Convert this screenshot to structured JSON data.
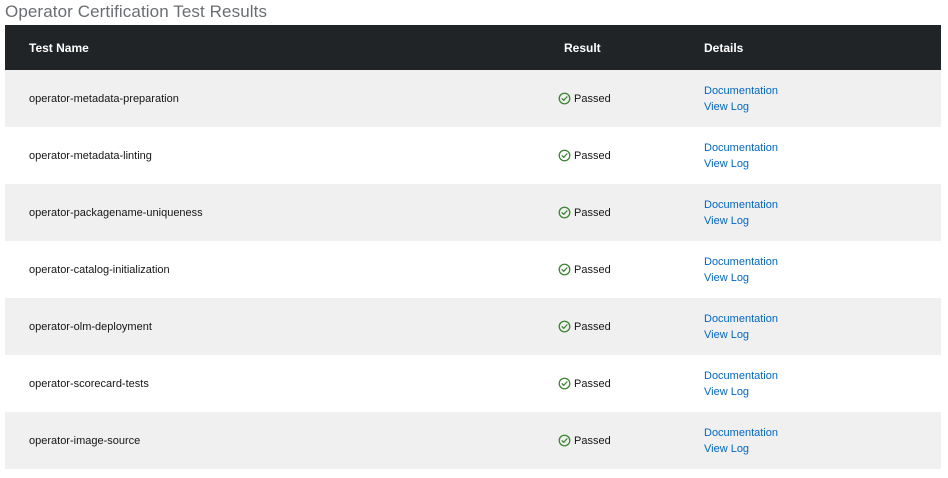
{
  "page": {
    "title": "Operator Certification Test Results"
  },
  "table": {
    "headers": {
      "name": "Test Name",
      "result": "Result",
      "details": "Details"
    },
    "rows": [
      {
        "name": "operator-metadata-preparation",
        "result": "Passed",
        "doc_link": "Documentation",
        "log_link": "View Log",
        "status_icon": "check-circle-icon",
        "status_color": "#3e8635"
      },
      {
        "name": "operator-metadata-linting",
        "result": "Passed",
        "doc_link": "Documentation",
        "log_link": "View Log",
        "status_icon": "check-circle-icon",
        "status_color": "#3e8635"
      },
      {
        "name": "operator-packagename-uniqueness",
        "result": "Passed",
        "doc_link": "Documentation",
        "log_link": "View Log",
        "status_icon": "check-circle-icon",
        "status_color": "#3e8635"
      },
      {
        "name": "operator-catalog-initialization",
        "result": "Passed",
        "doc_link": "Documentation",
        "log_link": "View Log",
        "status_icon": "check-circle-icon",
        "status_color": "#3e8635"
      },
      {
        "name": "operator-olm-deployment",
        "result": "Passed",
        "doc_link": "Documentation",
        "log_link": "View Log",
        "status_icon": "check-circle-icon",
        "status_color": "#3e8635"
      },
      {
        "name": "operator-scorecard-tests",
        "result": "Passed",
        "doc_link": "Documentation",
        "log_link": "View Log",
        "status_icon": "check-circle-icon",
        "status_color": "#3e8635"
      },
      {
        "name": "operator-image-source",
        "result": "Passed",
        "doc_link": "Documentation",
        "log_link": "View Log",
        "status_icon": "check-circle-icon",
        "status_color": "#3e8635"
      }
    ]
  },
  "colors": {
    "header_bg": "#212427",
    "row_alt_bg": "#f0f0f0",
    "link": "#0066cc",
    "title": "#6a6e73"
  }
}
